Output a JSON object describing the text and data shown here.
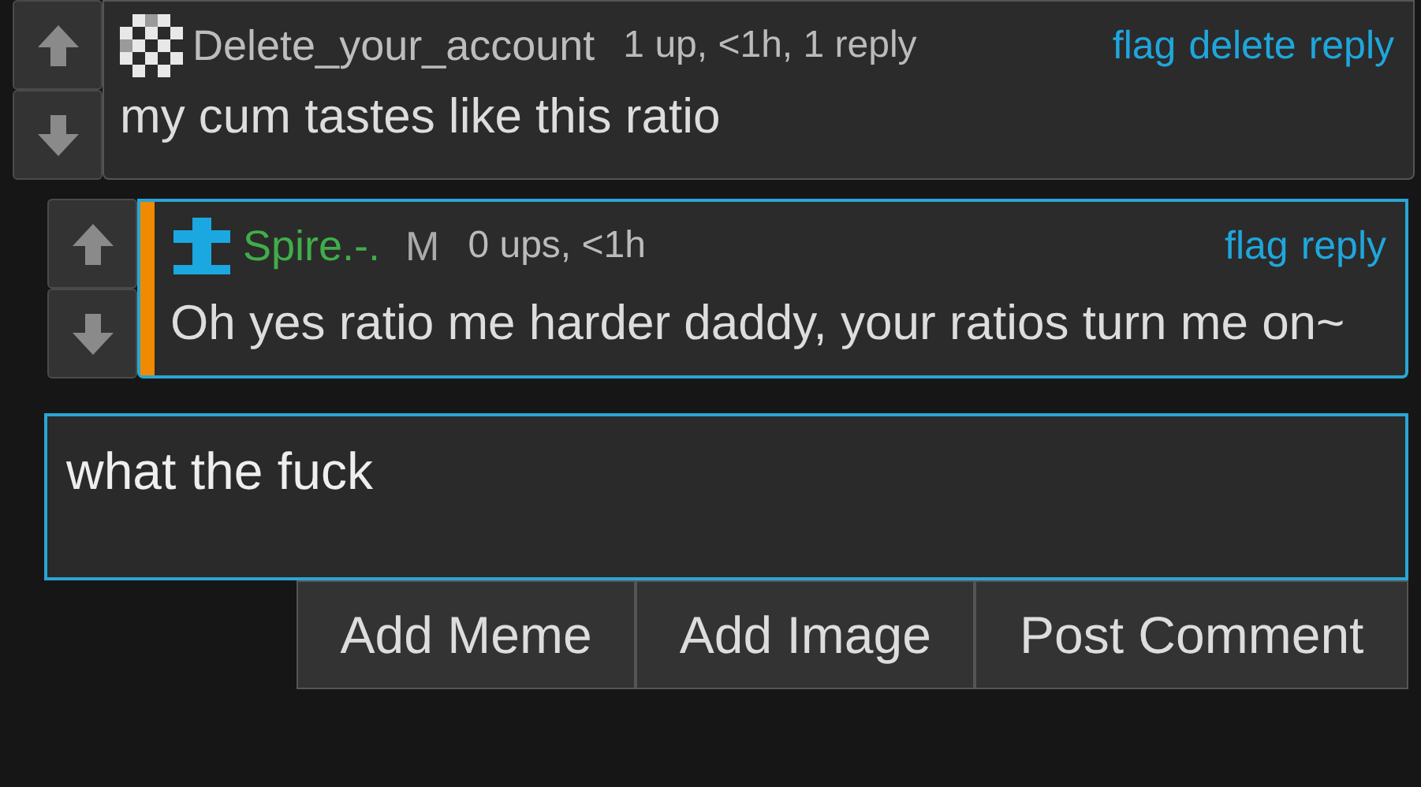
{
  "comments": [
    {
      "kind": "top",
      "username": "Delete_your_account",
      "color": "#bdbdbd",
      "meta": "1 up, <1h, 1 reply",
      "actions": [
        "flag",
        "delete",
        "reply"
      ],
      "text": "my cum tastes like this ratio",
      "highlighted": false
    },
    {
      "kind": "reply",
      "username": "Spire.-.",
      "color": "#3fae49",
      "badge": "M",
      "meta": "0 ups, <1h",
      "actions": [
        "flag",
        "reply"
      ],
      "text": "Oh yes ratio me harder daddy, your ratios turn me on~",
      "highlighted": true
    }
  ],
  "reply_box": {
    "value": "what the fuck"
  },
  "buttons": [
    "Add Meme",
    "Add Image",
    "Post Comment"
  ]
}
